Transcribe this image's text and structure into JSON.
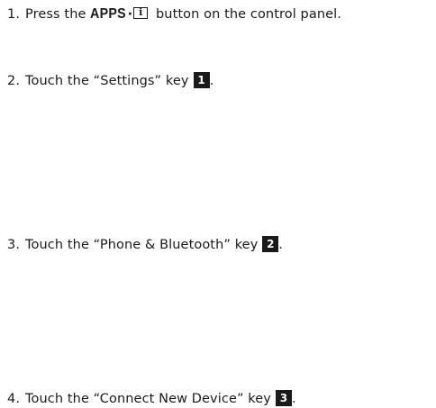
{
  "steps": [
    {
      "number": "1.",
      "pre": "Press the ",
      "button_label": "APPS",
      "separator": "·",
      "icon_glyph": "i",
      "icon": "info-icon",
      "post": " button on the control panel."
    },
    {
      "number": "2.",
      "pre": "Touch the “Settings” key",
      "badge": "1",
      "post": "."
    },
    {
      "number": "3.",
      "pre": "Touch the “Phone & Bluetooth” key",
      "badge": "2",
      "post": "."
    },
    {
      "number": "4.",
      "pre": "Touch the “Connect New Device” key",
      "badge": "3",
      "post": "."
    }
  ],
  "colors": {
    "text": "#1a1a1a",
    "background": "#ffffff",
    "badge_bg": "#1a1a1a",
    "badge_text": "#ffffff"
  }
}
